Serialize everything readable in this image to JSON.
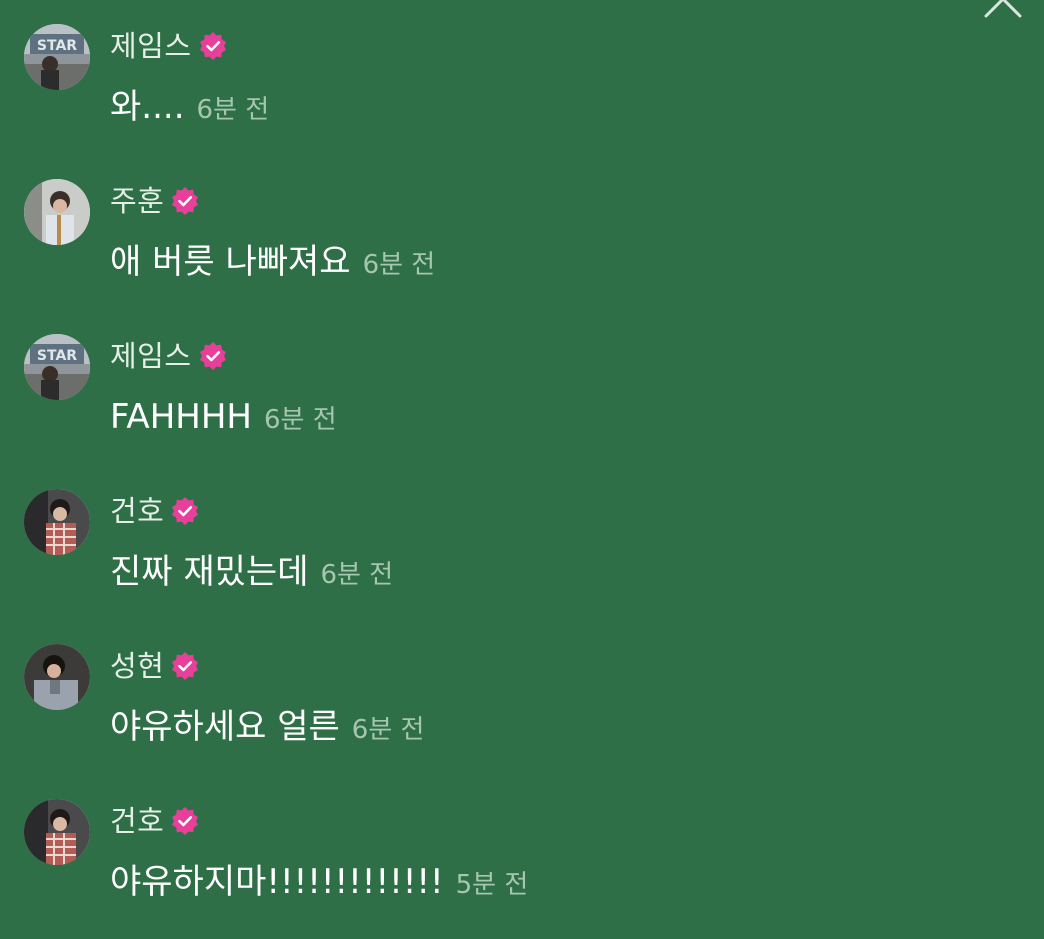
{
  "header": {
    "close_icon": "close-icon"
  },
  "colors": {
    "background": "#2f6f47",
    "verified_badge": "#e8409a",
    "author_name": "#e4efe7",
    "timestamp": "#a6c6b0",
    "message": "#ffffff"
  },
  "comments": [
    {
      "author": "제임스",
      "verified": true,
      "avatar": "avatar-james",
      "message": "와....",
      "time": "6분 전"
    },
    {
      "author": "주훈",
      "verified": true,
      "avatar": "avatar-joohoon",
      "message": "애 버릇 나빠져요",
      "time": "6분 전"
    },
    {
      "author": "제임스",
      "verified": true,
      "avatar": "avatar-james",
      "message": "FAHHHH",
      "time": "6분 전"
    },
    {
      "author": "건호",
      "verified": true,
      "avatar": "avatar-geonho",
      "message": "진짜 재밌는데",
      "time": "6분 전"
    },
    {
      "author": "성현",
      "verified": true,
      "avatar": "avatar-sunghyun",
      "message": "야유하세요 얼른",
      "time": "6분 전"
    },
    {
      "author": "건호",
      "verified": true,
      "avatar": "avatar-geonho",
      "message": "야유하지마!!!!!!!!!!!!!",
      "time": "5분 전"
    }
  ]
}
